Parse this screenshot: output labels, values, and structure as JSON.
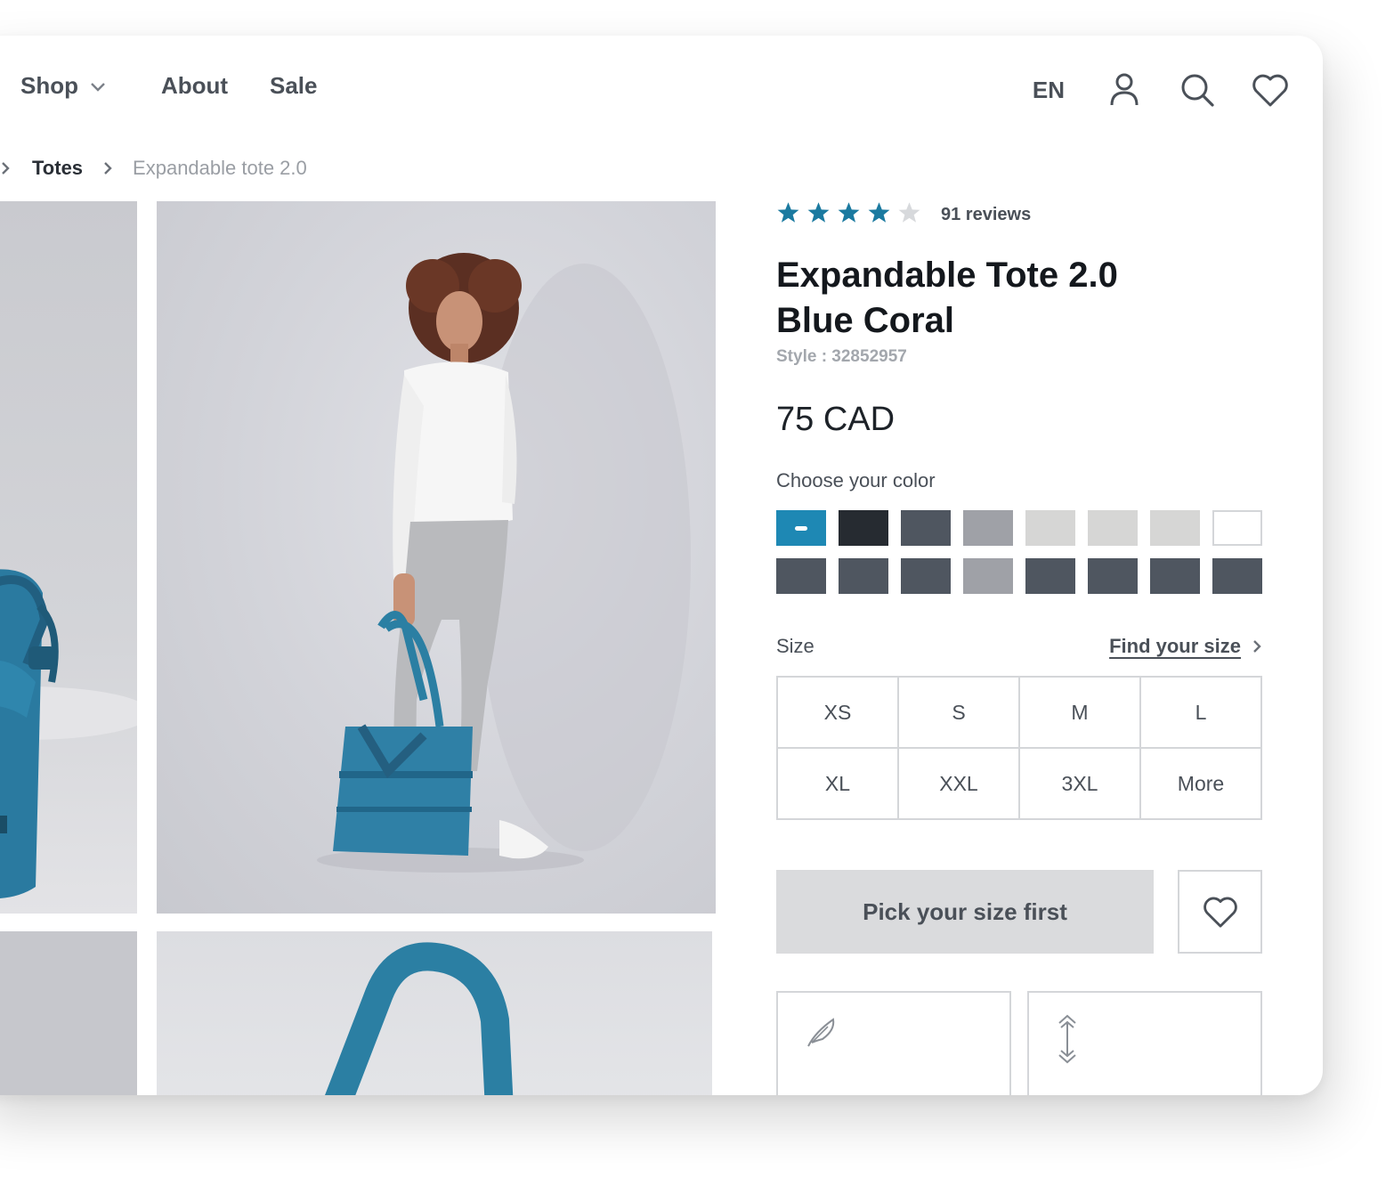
{
  "nav": {
    "shop": "Shop",
    "about": "About",
    "sale": "Sale",
    "language": "EN"
  },
  "breadcrumb": {
    "category": "Totes",
    "current": "Expandable tote 2.0"
  },
  "product": {
    "rating": 4,
    "rating_max": 5,
    "reviews": "91 reviews",
    "title_line1": "Expandable Tote 2.0",
    "title_line2": "Blue Coral",
    "style": "Style : 32852957",
    "price": "75 CAD",
    "color_label": "Choose your color",
    "colors": [
      "#1e88b4",
      "#262b31",
      "#4f5660",
      "#9fa1a7",
      "#d6d6d5",
      "#d6d6d5",
      "#d6d6d5",
      "#ffffff",
      "#4f5660",
      "#4f5660",
      "#4f5660",
      "#9fa1a7",
      "#4f5660",
      "#4f5660",
      "#4f5660",
      "#4f5660"
    ],
    "selected_color_index": 0,
    "size_label": "Size",
    "find_size": "Find your size",
    "sizes": [
      "XS",
      "S",
      "M",
      "L",
      "XL",
      "XXL",
      "3XL",
      "More"
    ],
    "cta": "Pick your size first"
  },
  "colors": {
    "star_filled": "#1b7aa0",
    "star_empty": "#d7d9dc",
    "bag_blue": "#2b7fa3"
  },
  "icons": {
    "wishlist_nav": "heart-icon",
    "account": "user-icon",
    "search": "search-icon",
    "features": [
      "feather-icon",
      "expand-arrows-icon"
    ]
  }
}
